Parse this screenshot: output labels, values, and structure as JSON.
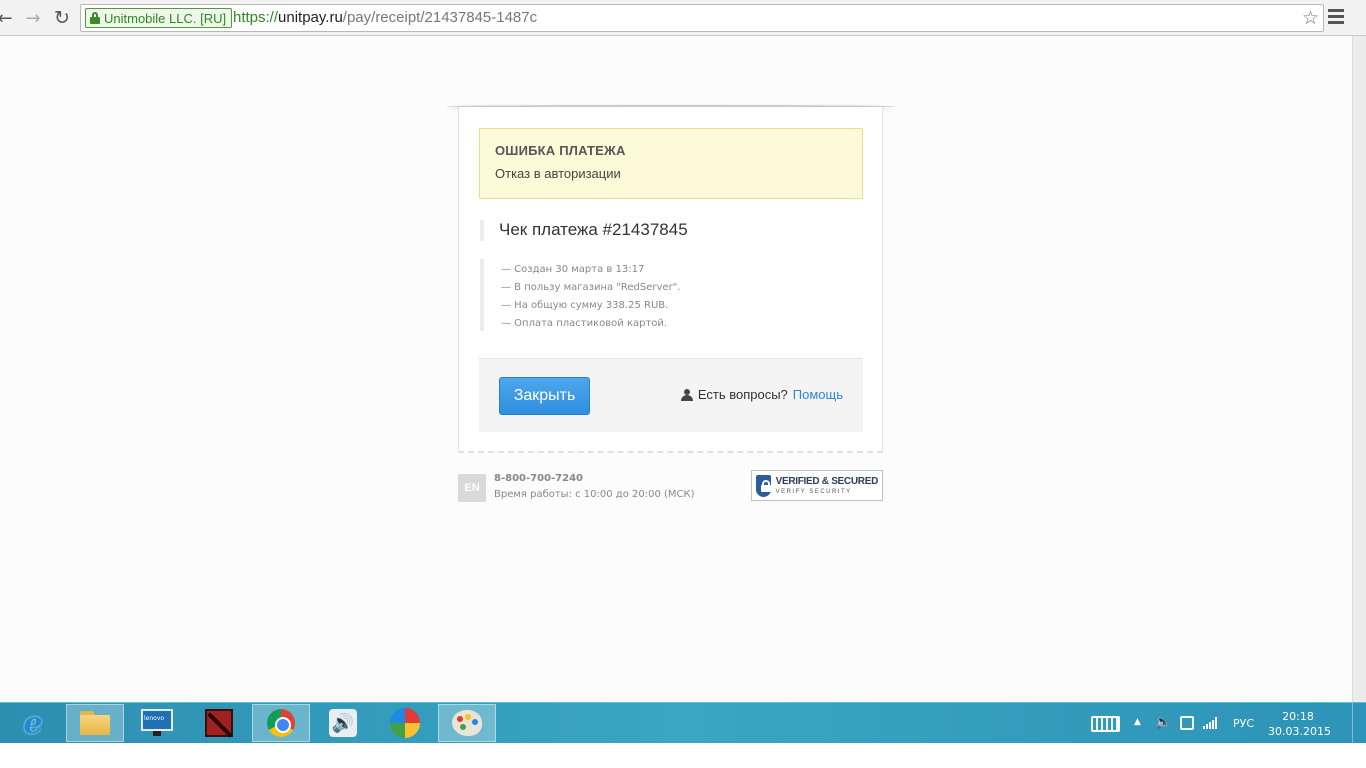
{
  "browser": {
    "ev_certificate": "Unitmobile LLC. [RU]",
    "url": {
      "scheme": "https://",
      "host": "unitpay.ru",
      "path": "/pay/receipt/21437845-1487c"
    },
    "icons": {
      "back": "back-arrow-icon",
      "forward": "forward-arrow-icon",
      "reload": "reload-icon",
      "bookmark": "star-icon",
      "menu": "hamburger-menu-icon"
    }
  },
  "alert": {
    "title": "ОШИБКА ПЛАТЕЖА",
    "message": "Отказ в авторизации",
    "background": "#fdfbd7",
    "border": "#eedc8a"
  },
  "receipt": {
    "title": "Чек платежа #21437845",
    "details": [
      "— Создан 30 марта в 13:17",
      "— В пользу магазина \"RedServer\".",
      "— На общую сумму 338.25 RUB.",
      "— Оплата пластиковой картой."
    ]
  },
  "actions": {
    "close_label": "Закрыть",
    "help_question": "Есть вопросы?",
    "help_link": "Помощь",
    "accent": "#2f8ee0"
  },
  "footer": {
    "language": "EN",
    "phone": "8-800-700-7240",
    "hours": "Время работы: с 10:00 до 20:00 (МСК)",
    "verified_line1": "VERIFIED & SECURED",
    "verified_line2": "VERIFY SECURITY"
  },
  "taskbar": {
    "apps": [
      {
        "name": "internet-explorer-icon",
        "active": false
      },
      {
        "name": "file-explorer-icon",
        "active": true
      },
      {
        "name": "lenovo-monitor-icon",
        "active": false
      },
      {
        "name": "dota2-icon",
        "active": false
      },
      {
        "name": "chrome-icon",
        "active": true
      },
      {
        "name": "speaker-app-icon",
        "active": false
      },
      {
        "name": "bubble-app-icon",
        "active": false
      },
      {
        "name": "paint-icon",
        "active": true
      }
    ],
    "lenovo_label": "lenovo",
    "input_language": "РУС",
    "time": "20:18",
    "date": "30.03.2015"
  }
}
